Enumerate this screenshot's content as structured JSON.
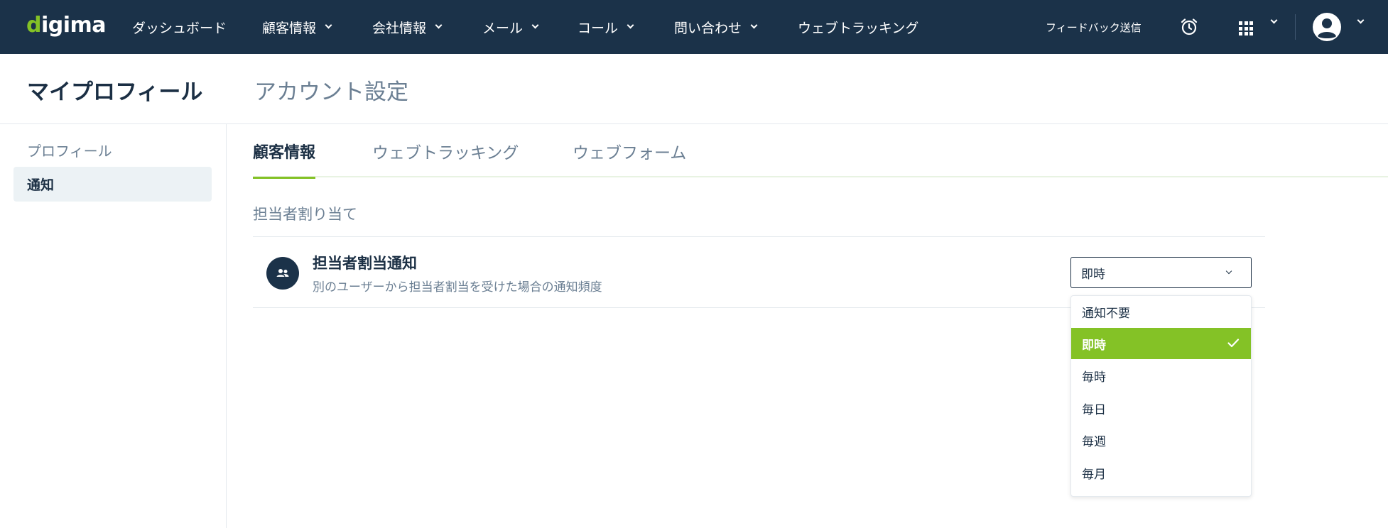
{
  "app": {
    "logo": {
      "prefix": "d",
      "rest": "igima"
    },
    "brand_color": "#84c226",
    "nav_bg_color": "#1b3249"
  },
  "nav": {
    "items": [
      {
        "label": "ダッシュボード",
        "has_dropdown": false
      },
      {
        "label": "顧客情報",
        "has_dropdown": true
      },
      {
        "label": "会社情報",
        "has_dropdown": true
      },
      {
        "label": "メール",
        "has_dropdown": true
      },
      {
        "label": "コール",
        "has_dropdown": true
      },
      {
        "label": "問い合わせ",
        "has_dropdown": true
      },
      {
        "label": "ウェブトラッキング",
        "has_dropdown": false
      }
    ],
    "feedback": "フィードバック送信",
    "icons": [
      "alarm-clock-icon",
      "apps-grid-icon",
      "user-avatar-icon"
    ]
  },
  "header": {
    "title": "マイプロフィール",
    "subtitle": "アカウント設定"
  },
  "sidebar": {
    "items": [
      {
        "label": "プロフィール",
        "active": false
      },
      {
        "label": "通知",
        "active": true
      }
    ]
  },
  "tabs": [
    {
      "label": "顧客情報",
      "active": true
    },
    {
      "label": "ウェブトラッキング",
      "active": false
    },
    {
      "label": "ウェブフォーム",
      "active": false
    }
  ],
  "section": {
    "title": "担当者割り当て",
    "setting": {
      "icon": "people-icon",
      "title": "担当者割当通知",
      "description": "別のユーザーから担当者割当を受けた場合の通知頻度",
      "selected": "即時",
      "options": [
        "通知不要",
        "即時",
        "毎時",
        "毎日",
        "毎週",
        "毎月"
      ]
    }
  }
}
